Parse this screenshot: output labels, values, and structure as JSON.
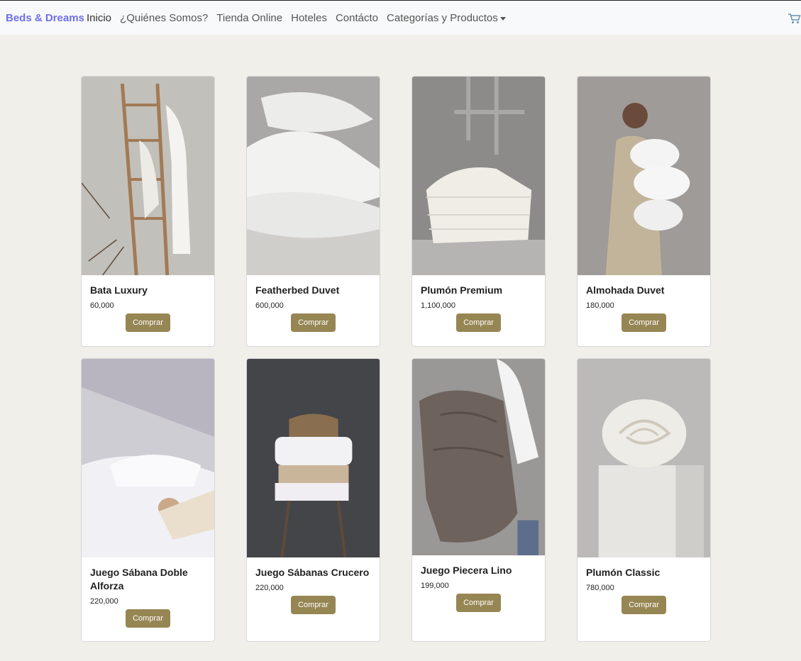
{
  "navbar": {
    "brand": "Beds & Dreams",
    "links": [
      "Inicio",
      "¿Quiénes Somos?",
      "Tienda Online",
      "Hoteles",
      "Contácto",
      "Categorías y Productos"
    ],
    "cart_icon": "cart-icon"
  },
  "products": [
    {
      "name": "Bata Luxury",
      "price": "60,000",
      "button": "Comprar"
    },
    {
      "name": "Featherbed Duvet",
      "price": "600,000",
      "button": "Comprar"
    },
    {
      "name": "Plumón Premium",
      "price": "1,100,000",
      "button": "Comprar"
    },
    {
      "name": "Almohada Duvet",
      "price": "180,000",
      "button": "Comprar"
    },
    {
      "name": "Juego Sábana Doble Alforza",
      "price": "220,000",
      "button": "Comprar"
    },
    {
      "name": "Juego Sábanas Crucero",
      "price": "220,000",
      "button": "Comprar"
    },
    {
      "name": "Juego Piecera Lino",
      "price": "199,000",
      "button": "Comprar"
    },
    {
      "name": "Plumón Classic",
      "price": "780,000",
      "button": "Comprar"
    }
  ],
  "colors": {
    "brand": "#6f6fe8",
    "button": "#968653",
    "background": "#f1efea"
  }
}
